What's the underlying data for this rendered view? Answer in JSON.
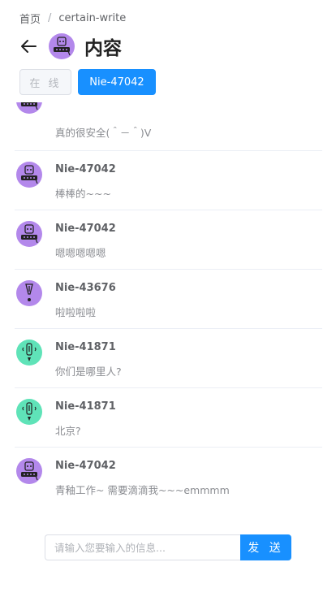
{
  "breadcrumb": {
    "home": "首页",
    "separator": "/",
    "current": "certain-write"
  },
  "header": {
    "back_icon": "arrow-left-icon",
    "title": "内容"
  },
  "buttons": {
    "online": "在 线",
    "user": "Nie-47042"
  },
  "colors": {
    "accent": "#1890ff",
    "purple": "#b388eb",
    "green": "#5fe3b8"
  },
  "messages": [
    {
      "name": "",
      "text": "真的很安全(＾－＾)V",
      "avatar": "purple"
    },
    {
      "name": "Nie-47042",
      "text": "棒棒的~~~",
      "avatar": "purple"
    },
    {
      "name": "Nie-47042",
      "text": "嗯嗯嗯嗯嗯",
      "avatar": "purple"
    },
    {
      "name": "Nie-43676",
      "text": "啦啦啦啦",
      "avatar": "purple-alt"
    },
    {
      "name": "Nie-41871",
      "text": "你们是哪里人?",
      "avatar": "green"
    },
    {
      "name": "Nie-41871",
      "text": "北京?",
      "avatar": "green"
    },
    {
      "name": "Nie-47042",
      "text": "青釉工作~ 需要滴滴我~~~emmmm",
      "avatar": "purple"
    }
  ],
  "composer": {
    "placeholder": "请输入您要输入的信息...",
    "send_label": "发 送"
  }
}
